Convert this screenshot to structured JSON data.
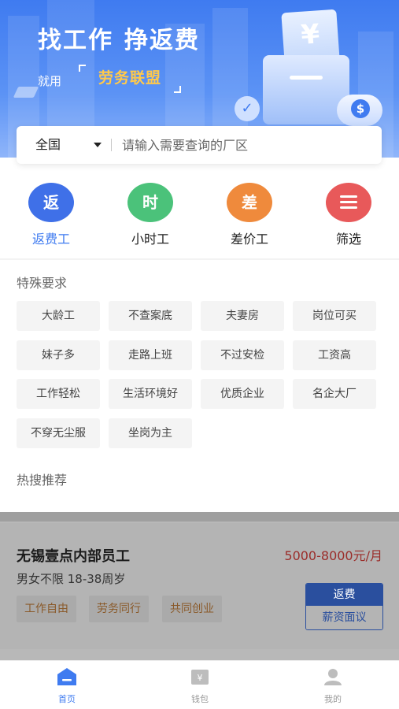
{
  "banner": {
    "title_part1": "找工作",
    "title_part2": "挣返费",
    "sub_prefix": "就用",
    "brand": "劳务联盟"
  },
  "search": {
    "region": "全国",
    "placeholder": "请输入需要查询的厂区"
  },
  "categories": [
    {
      "icon_char": "返",
      "label": "返费工",
      "color": "#3f70e8",
      "active": true
    },
    {
      "icon_char": "时",
      "label": "小时工",
      "color": "#4bc27a",
      "active": false
    },
    {
      "icon_char": "差",
      "label": "差价工",
      "color": "#ef8a3c",
      "active": false
    },
    {
      "icon_char": "menu-icon",
      "label": "筛选",
      "color": "#e8595a",
      "active": false
    }
  ],
  "special": {
    "title": "特殊要求",
    "tags": [
      "大龄工",
      "不查案底",
      "夫妻房",
      "岗位可买",
      "妹子多",
      "走路上班",
      "不过安检",
      "工资高",
      "工作轻松",
      "生活环境好",
      "优质企业",
      "名企大厂",
      "不穿无尘服",
      "坐岗为主"
    ]
  },
  "hot": {
    "title": "热搜推荐"
  },
  "job": {
    "title": "无锡壹点内部员工",
    "salary": "5000-8000元/月",
    "meta": "男女不限 18-38周岁",
    "perks": [
      "工作自由",
      "劳务同行",
      "共同创业"
    ],
    "badge_top": "返费",
    "badge_bottom": "薪资面议"
  },
  "tabs": [
    {
      "label": "首页",
      "icon": "home-icon",
      "active": true
    },
    {
      "label": "钱包",
      "icon": "wallet-icon",
      "active": false
    },
    {
      "label": "我的",
      "icon": "user-icon",
      "active": false
    }
  ],
  "colors": {
    "primary": "#3f7bf0",
    "salary": "#9b2d2a",
    "brand_gold": "#ffc94a"
  }
}
